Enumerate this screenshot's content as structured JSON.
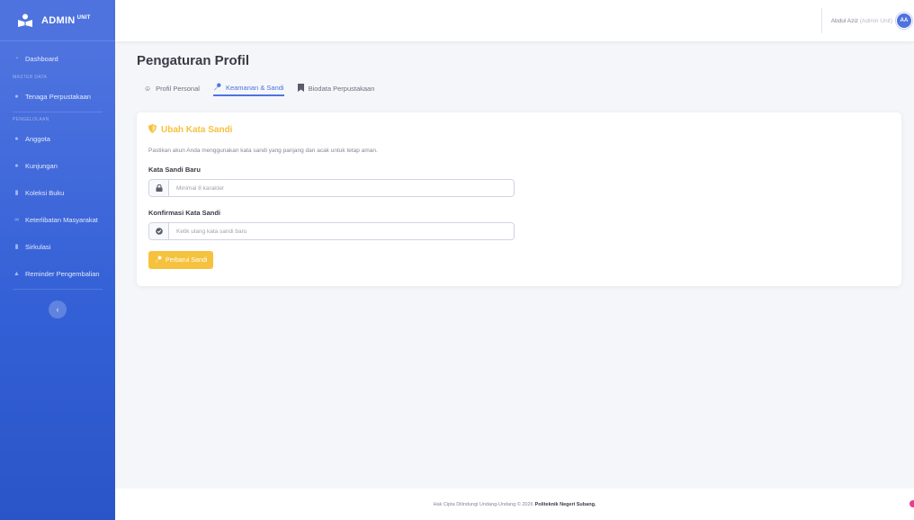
{
  "brand": {
    "name": "ADMIN",
    "suffix": "UNIT"
  },
  "sidebar": {
    "items": [
      {
        "label": "Dashboard",
        "icon": "dashboard-icon"
      },
      {
        "section": "MASTER DATA"
      },
      {
        "label": "Tenaga Perpustakaan",
        "icon": "user-icon"
      },
      {
        "section": "PENGELOLAAN"
      },
      {
        "label": "Anggota",
        "icon": "users-icon"
      },
      {
        "label": "Kunjungan",
        "icon": "user-check-icon"
      },
      {
        "label": "Koleksi Buku",
        "icon": "book-icon"
      },
      {
        "label": "Keterlibatan Masyarakat",
        "icon": "handshake-icon"
      },
      {
        "label": "Sirkulasi",
        "icon": "circulation-icon"
      },
      {
        "label": "Reminder Pengembalian",
        "icon": "bell-icon"
      }
    ],
    "toggle_glyph": "‹"
  },
  "topbar": {
    "user_name": "Abdul Aziz",
    "user_role": "(Admin Unit)",
    "avatar_initials": "AA"
  },
  "page": {
    "title": "Pengaturan Profil",
    "tabs": [
      {
        "label": "Profil Personal",
        "icon": "user-edit-icon",
        "active": false
      },
      {
        "label": "Keamanan & Sandi",
        "icon": "key-icon",
        "active": true
      },
      {
        "label": "Biodata Perpustakaan",
        "icon": "bookmark-icon",
        "active": false
      }
    ]
  },
  "form": {
    "title": "Ubah Kata Sandi",
    "description": "Pastikan akun Anda menggunakan kata sandi yang panjang dan acak untuk tetap aman.",
    "new_password_label": "Kata Sandi Baru",
    "new_password_placeholder": "Minimal 8 karakter",
    "confirm_label": "Konfirmasi Kata Sandi",
    "confirm_placeholder": "Ketik ulang kata sandi baru",
    "submit_label": "Perbarui Sandi"
  },
  "footer": {
    "text": "Hak Cipta Dilindungi Undang-Undang © 2026",
    "org": "Politeknik Negeri Subang."
  },
  "colors": {
    "primary": "#4e73df",
    "warning": "#f6c23e"
  }
}
